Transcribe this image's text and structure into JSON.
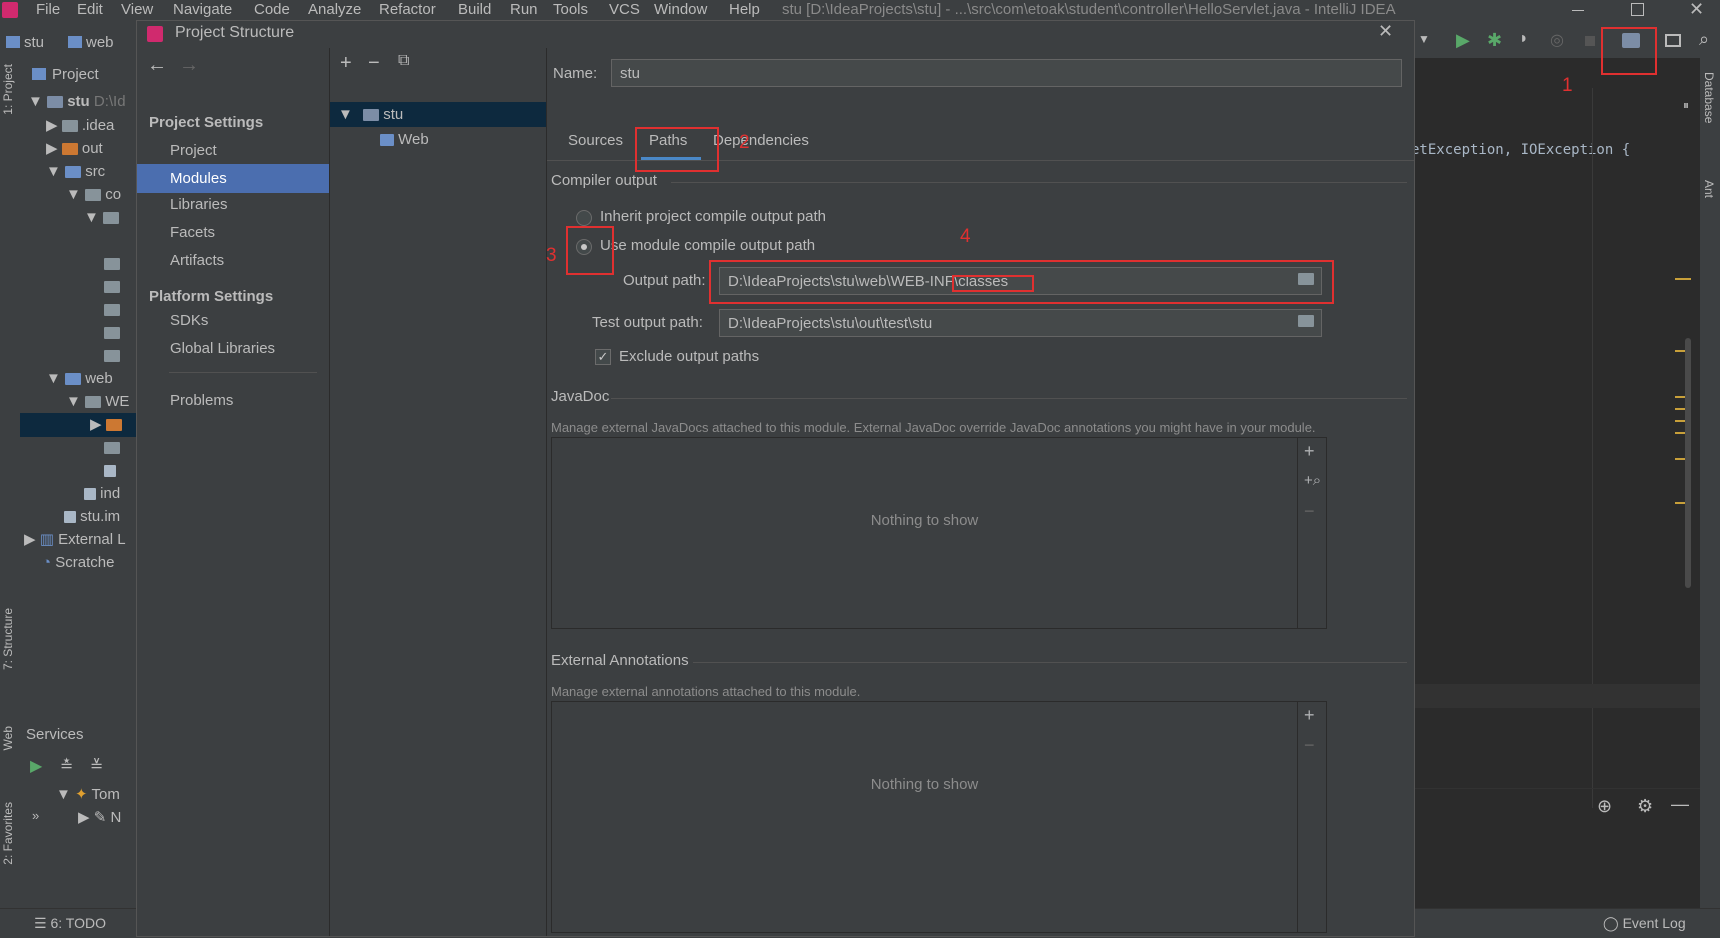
{
  "menu": {
    "items": [
      "File",
      "Edit",
      "View",
      "Navigate",
      "Code",
      "Analyze",
      "Refactor",
      "Build",
      "Run",
      "Tools",
      "VCS",
      "Window",
      "Help"
    ],
    "window_title": "stu [D:\\IdeaProjects\\stu] - ...\\src\\com\\etoak\\student\\controller\\HelloServlet.java - IntelliJ IDEA"
  },
  "navbar": {
    "crumbs": [
      "stu",
      "web"
    ]
  },
  "left_strip": {
    "project_tab": "1: Project",
    "structure_tab": "7: Structure",
    "web_tab": "Web",
    "favorites_tab": "2: Favorites"
  },
  "project_panel": {
    "title": "Project",
    "rows": [
      "stu",
      "D:\\Id",
      ".idea",
      "out",
      "src",
      "co",
      "web",
      "WE",
      "ind",
      "stu.im",
      "External L",
      "Scratche"
    ]
  },
  "services": {
    "title": "Services",
    "tom": "Tom",
    "n": "N"
  },
  "statusbar": {
    "todo": "6: TODO",
    "event_log": "Event Log"
  },
  "editor": {
    "code_line": "etException, IOException {",
    "right_tabs": [
      "Database",
      "Ant"
    ]
  },
  "dialog": {
    "title": "Project Structure",
    "sidebar": {
      "project_settings": "Project Settings",
      "items_ps": [
        "Project",
        "Modules",
        "Libraries",
        "Facets",
        "Artifacts"
      ],
      "platform_settings": "Platform Settings",
      "items_pl": [
        "SDKs",
        "Global Libraries"
      ],
      "problems": "Problems"
    },
    "module_tree": {
      "root": "stu",
      "child": "Web"
    },
    "name_label": "Name:",
    "name_value": "stu",
    "tabs": [
      "Sources",
      "Paths",
      "Dependencies"
    ],
    "compiler_output": "Compiler output",
    "radio_inherit": "Inherit project compile output path",
    "radio_use": "Use module compile output path",
    "output_label": "Output path:",
    "output_value": "D:\\IdeaProjects\\stu\\web\\WEB-INF\\classes",
    "test_label": "Test output path:",
    "test_value": "D:\\IdeaProjects\\stu\\out\\test\\stu",
    "exclude_label": "Exclude output paths",
    "javadoc_title": "JavaDoc",
    "javadoc_hint": "Manage external JavaDocs attached to this module. External JavaDoc override JavaDoc annotations you might have in your module.",
    "nothing": "Nothing to show",
    "ext_title": "External Annotations",
    "ext_hint": "Manage external annotations attached to this module."
  },
  "annotations": [
    "1",
    "2",
    "3",
    "4"
  ],
  "colors": {
    "accent": "#4b6eaf",
    "annotation": "#e03030",
    "run_green": "#59a869"
  }
}
